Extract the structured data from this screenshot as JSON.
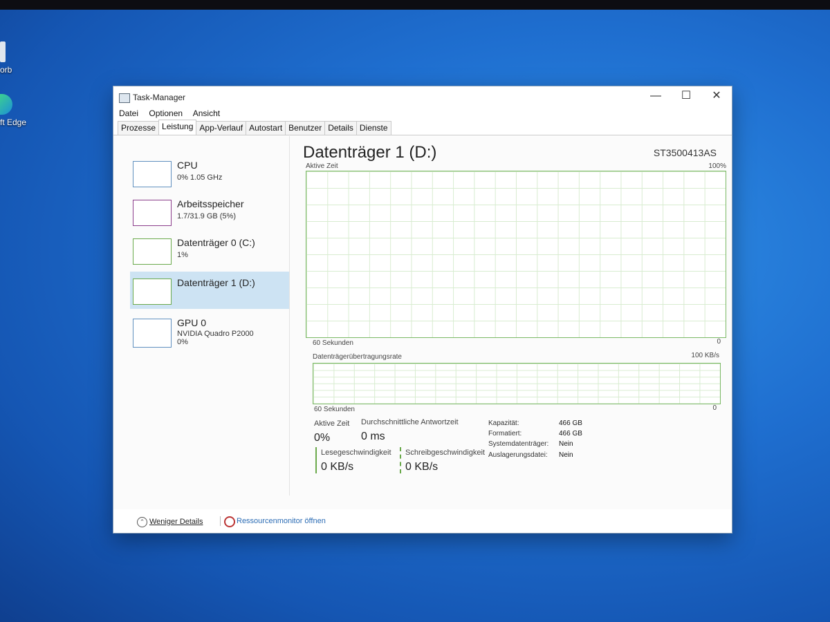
{
  "desktop": {
    "icons": [
      {
        "label": "orb"
      },
      {
        "label": "ft Edge"
      }
    ]
  },
  "window": {
    "title": "Task-Manager",
    "controls": {
      "minimize": "—",
      "maximize": "☐",
      "close": "✕"
    }
  },
  "menu": [
    "Datei",
    "Optionen",
    "Ansicht"
  ],
  "tabs": [
    "Prozesse",
    "Leistung",
    "App-Verlauf",
    "Autostart",
    "Benutzer",
    "Details",
    "Dienste"
  ],
  "sidebar": {
    "items": [
      {
        "name": "CPU",
        "sub": "0% 1.05 GHz",
        "sub2": ""
      },
      {
        "name": "Arbeitsspeicher",
        "sub": "1.7/31.9 GB (5%)",
        "sub2": ""
      },
      {
        "name": "Datenträger 0 (C:)",
        "sub": "1%",
        "sub2": ""
      },
      {
        "name": "Datenträger 1 (D:)",
        "sub": "",
        "sub2": ""
      },
      {
        "name": "GPU 0",
        "sub": "NVIDIA Quadro P2000",
        "sub2": "0%"
      }
    ]
  },
  "main": {
    "heading": "Datenträger 1 (D:)",
    "model": "ST3500413AS",
    "graph1": {
      "label": "Aktive Zeit",
      "max": "100%",
      "time": "60 Sekunden",
      "min": "0"
    },
    "graph2": {
      "label": "Datenträgerübertragungsrate",
      "max": "100 KB/s",
      "time": "60 Sekunden",
      "min": "0"
    },
    "stats": {
      "active_label": "Aktive Zeit",
      "active_value": "0%",
      "resp_label": "Durchschnittliche Antwortzeit",
      "resp_value": "0 ms",
      "read_label": "Lesegeschwindigkeit",
      "read_value": "0 KB/s",
      "write_label": "Schreibgeschwindigkeit",
      "write_value": "0 KB/s"
    },
    "props": [
      {
        "key": "Kapazität:",
        "value": "466 GB"
      },
      {
        "key": "Formatiert:",
        "value": "466 GB"
      },
      {
        "key": "Systemdatenträger:",
        "value": "Nein"
      },
      {
        "key": "Auslagerungsdatei:",
        "value": "Nein"
      }
    ]
  },
  "footer": {
    "less_details": "Weniger Details",
    "resource_monitor": "Ressourcenmonitor öffnen"
  }
}
